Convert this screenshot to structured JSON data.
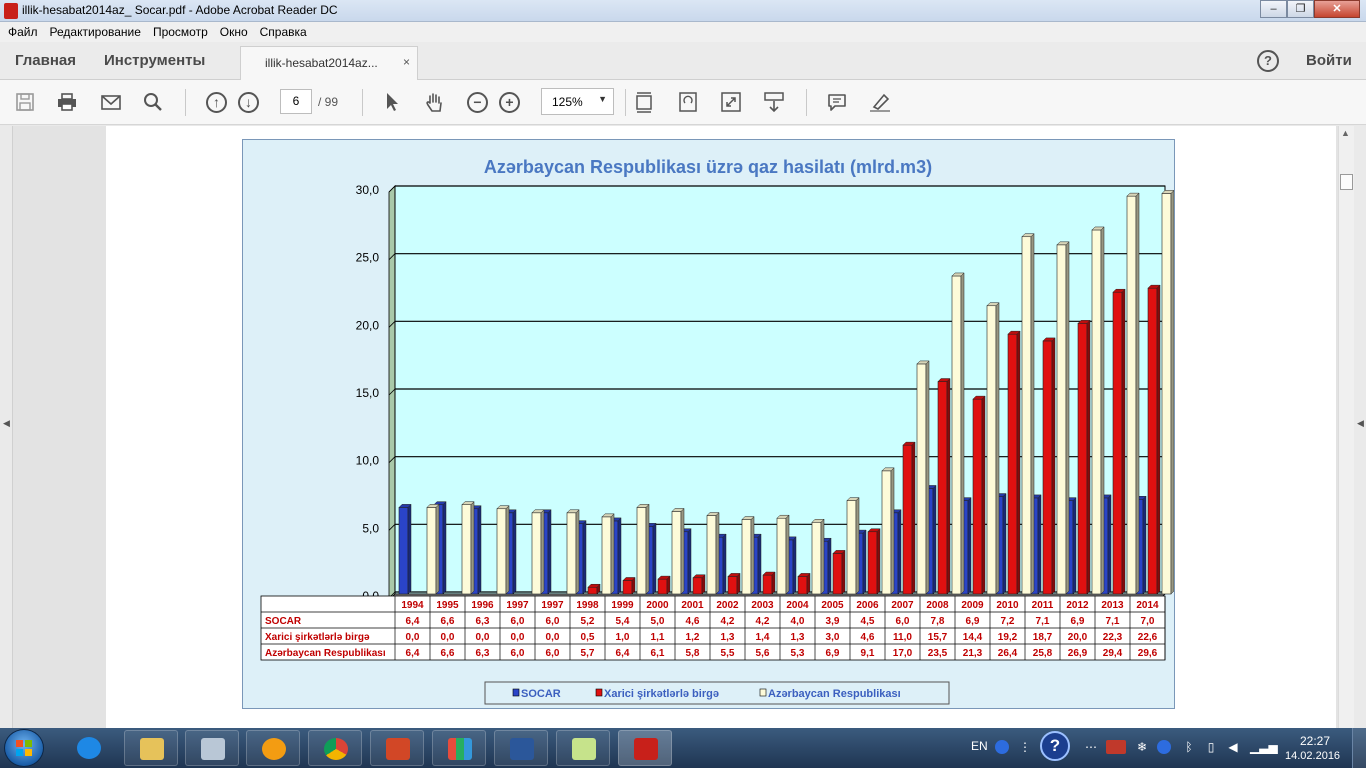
{
  "window": {
    "title": "illik-hesabat2014az_ Socar.pdf - Adobe Acrobat Reader DC",
    "minimize": "–",
    "maximize": "❐",
    "close": "✕"
  },
  "menu": [
    "Файл",
    "Редактирование",
    "Просмотр",
    "Окно",
    "Справка"
  ],
  "tabs": {
    "home": "Главная",
    "tools": "Инструменты",
    "document": "illik-hesabat2014az...",
    "close": "×",
    "help": "?",
    "signin": "Войти"
  },
  "toolbar": {
    "page_current": "6",
    "page_total": "/ 99",
    "zoom": "125%",
    "icons": [
      "save-icon",
      "print-icon",
      "email-icon",
      "search-icon",
      "prev-page-icon",
      "next-page-icon",
      "select-icon",
      "hand-icon",
      "zoom-out-icon",
      "zoom-in-icon",
      "fit-page-icon",
      "rotate-icon",
      "fullscreen-icon",
      "scroll-mode-icon",
      "comment-icon",
      "highlight-icon"
    ]
  },
  "taskbar": {
    "language": "EN",
    "help": "?",
    "time": "22:27",
    "date": "14.02.2016"
  },
  "chart_data": {
    "type": "bar",
    "title": "Azərbaycan Respublikası üzrə qaz hasilatı (mlrd.m3)",
    "categories": [
      "1994",
      "1995",
      "1996",
      "1997",
      "1997",
      "1998",
      "1999",
      "2000",
      "2001",
      "2002",
      "2003",
      "2004",
      "2005",
      "2006",
      "2007",
      "2008",
      "2009",
      "2010",
      "2011",
      "2012",
      "2013",
      "2014"
    ],
    "ylim": [
      0,
      30
    ],
    "yticks": [
      "0,0",
      "5,0",
      "10,0",
      "15,0",
      "20,0",
      "25,0",
      "30,0"
    ],
    "grid": true,
    "legend_position": "bottom",
    "series": [
      {
        "name": "SOCAR",
        "color": "#2a44c8",
        "values": [
          6.4,
          6.6,
          6.3,
          6.0,
          6.0,
          5.2,
          5.4,
          5.0,
          4.6,
          4.2,
          4.2,
          4.0,
          3.9,
          4.5,
          6.0,
          7.8,
          6.9,
          7.2,
          7.1,
          6.9,
          7.1,
          7.0
        ],
        "labels": [
          "6,4",
          "6,6",
          "6,3",
          "6,0",
          "6,0",
          "5,2",
          "5,4",
          "5,0",
          "4,6",
          "4,2",
          "4,2",
          "4,0",
          "3,9",
          "4,5",
          "6,0",
          "7,8",
          "6,9",
          "7,2",
          "7,1",
          "6,9",
          "7,1",
          "7,0"
        ]
      },
      {
        "name": "Xarici şirkətlərlə birgə",
        "color": "#e01010",
        "values": [
          0.0,
          0.0,
          0.0,
          0.0,
          0.0,
          0.5,
          1.0,
          1.1,
          1.2,
          1.3,
          1.4,
          1.3,
          3.0,
          4.6,
          11.0,
          15.7,
          14.4,
          19.2,
          18.7,
          20.0,
          22.3,
          22.6
        ],
        "labels": [
          "0,0",
          "0,0",
          "0,0",
          "0,0",
          "0,0",
          "0,5",
          "1,0",
          "1,1",
          "1,2",
          "1,3",
          "1,4",
          "1,3",
          "3,0",
          "4,6",
          "11,0",
          "15,7",
          "14,4",
          "19,2",
          "18,7",
          "20,0",
          "22,3",
          "22,6"
        ]
      },
      {
        "name": "Azərbaycan Respublikası",
        "color": "#fdfbd9",
        "values": [
          6.4,
          6.6,
          6.3,
          6.0,
          6.0,
          5.7,
          6.4,
          6.1,
          5.8,
          5.5,
          5.6,
          5.3,
          6.9,
          9.1,
          17.0,
          23.5,
          21.3,
          26.4,
          25.8,
          26.9,
          29.4,
          29.6
        ],
        "labels": [
          "6,4",
          "6,6",
          "6,3",
          "6,0",
          "6,0",
          "5,7",
          "6,4",
          "6,1",
          "5,8",
          "5,5",
          "5,6",
          "5,3",
          "6,9",
          "9,1",
          "17,0",
          "23,5",
          "21,3",
          "26,4",
          "25,8",
          "26,9",
          "29,4",
          "29,6"
        ]
      }
    ]
  }
}
